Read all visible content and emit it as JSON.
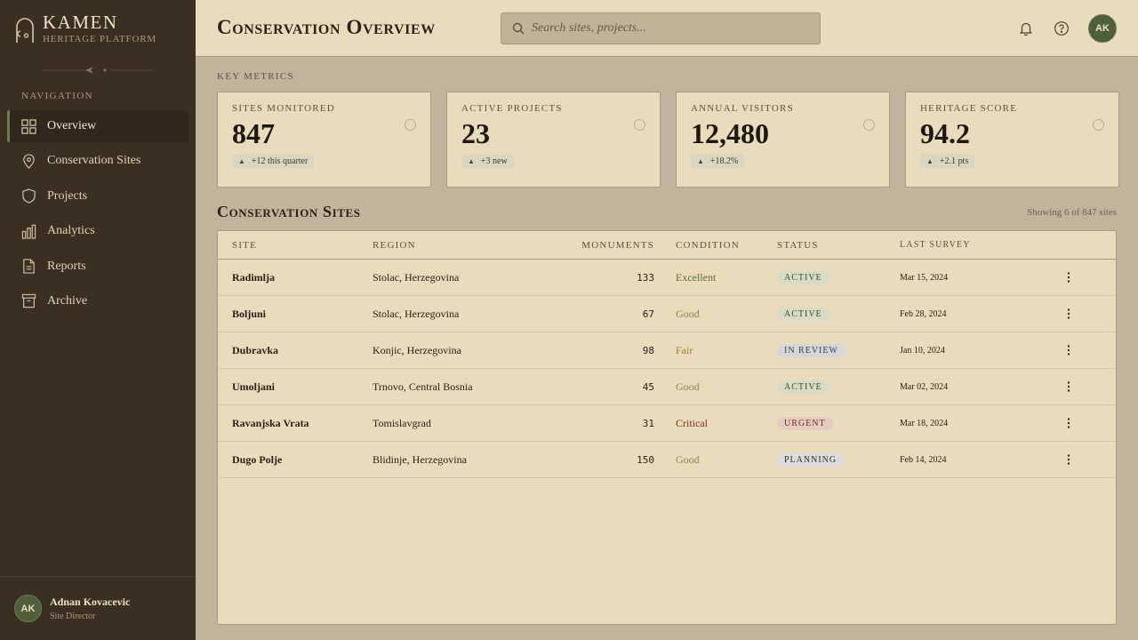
{
  "brand": {
    "name": "KAMEN",
    "subtitle": "HERITAGE PLATFORM"
  },
  "sidebar": {
    "nav_title": "NAVIGATION",
    "items": [
      {
        "label": "Overview",
        "icon": "grid-icon",
        "active": true
      },
      {
        "label": "Conservation Sites",
        "icon": "map-pin-icon"
      },
      {
        "label": "Projects",
        "icon": "shield-icon"
      },
      {
        "label": "Analytics",
        "icon": "bar-chart-icon"
      },
      {
        "label": "Reports",
        "icon": "document-icon"
      },
      {
        "label": "Archive",
        "icon": "archive-icon"
      }
    ],
    "user": {
      "initials": "AK",
      "name": "Adnan Kovacevic",
      "role": "Site Director"
    }
  },
  "header": {
    "title": "Conservation Overview",
    "search_placeholder": "Search sites, projects...",
    "avatar_initials": "AK"
  },
  "metrics": {
    "section_label": "KEY METRICS",
    "cards": [
      {
        "label": "SITES MONITORED",
        "value": "847",
        "delta": "+12 this quarter"
      },
      {
        "label": "ACTIVE PROJECTS",
        "value": "23",
        "delta": "+3 new"
      },
      {
        "label": "ANNUAL VISITORS",
        "value": "12,480",
        "delta": "+18.2%"
      },
      {
        "label": "HERITAGE SCORE",
        "value": "94.2",
        "delta": "+2.1 pts"
      }
    ]
  },
  "sites": {
    "title": "Conservation Sites",
    "count_text": "Showing 6 of 847 sites",
    "columns": {
      "site": "SITE",
      "region": "REGION",
      "monuments": "MONUMENTS",
      "condition": "CONDITION",
      "status": "STATUS",
      "survey": "LAST SURVEY"
    },
    "rows": [
      {
        "site": "Radimlja",
        "region": "Stolac, Herzegovina",
        "monuments": "133",
        "condition": "Excellent",
        "status": "ACTIVE",
        "survey": "Mar 15, 2024"
      },
      {
        "site": "Boljuni",
        "region": "Stolac, Herzegovina",
        "monuments": "67",
        "condition": "Good",
        "status": "ACTIVE",
        "survey": "Feb 28, 2024"
      },
      {
        "site": "Dubravka",
        "region": "Konjic, Herzegovina",
        "monuments": "98",
        "condition": "Fair",
        "status": "IN REVIEW",
        "survey": "Jan 10, 2024"
      },
      {
        "site": "Umoljani",
        "region": "Trnovo, Central Bosnia",
        "monuments": "45",
        "condition": "Good",
        "status": "ACTIVE",
        "survey": "Mar 02, 2024"
      },
      {
        "site": "Ravanjska Vrata",
        "region": "Tomislavgrad",
        "monuments": "31",
        "condition": "Critical",
        "status": "URGENT",
        "survey": "Mar 18, 2024"
      },
      {
        "site": "Dugo Polje",
        "region": "Blidinje, Herzegovina",
        "monuments": "150",
        "condition": "Good",
        "status": "PLANNING",
        "survey": "Feb 14, 2024"
      }
    ]
  },
  "colors": {
    "sidebar_bg": "#3b2e22",
    "surface": "#e8dcbc",
    "background": "#c0b49c",
    "accent_green": "#4f5f3c",
    "condition_excellent": "#5c6b3e",
    "condition_good": "#7c8a5c",
    "condition_fair": "#a07d2a",
    "condition_critical": "#8a2a22"
  }
}
